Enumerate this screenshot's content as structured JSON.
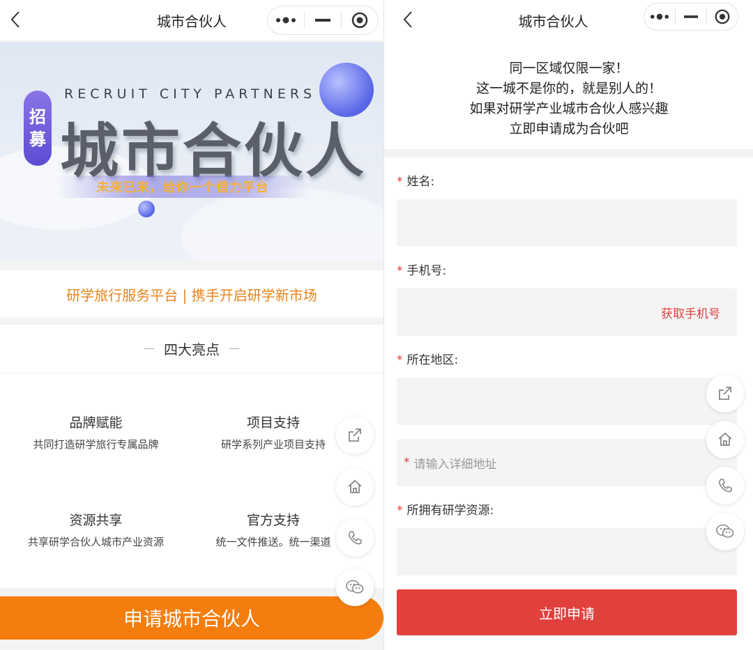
{
  "nav": {
    "title": "城市合伙人"
  },
  "banner": {
    "pill_chars": [
      "招",
      "募"
    ],
    "subtitle_en": "RECRUIT CITY PARTNERS",
    "main_title": "城市合伙人",
    "tagline": "未来已来，给你一个借力平台"
  },
  "slogan": "研学旅行服务平台 | 携手开启研学新市场",
  "features": {
    "heading": "四大亮点",
    "items": [
      {
        "title": "品牌赋能",
        "desc": "共同打造研学旅行专属品牌"
      },
      {
        "title": "项目支持",
        "desc": "研学系列产业项目支持"
      },
      {
        "title": "资源共享",
        "desc": "共享研学合伙人城市产业资源"
      },
      {
        "title": "官方支持",
        "desc": "统一文件推送。统一渠道"
      }
    ]
  },
  "apply_left": "申请城市合伙人",
  "intro": [
    "同一区域仅限一家！",
    "这一城不是你的，就是别人的！",
    "如果对研学产业城市合伙人感兴趣",
    "立即申请成为合伙吧"
  ],
  "form": {
    "required_mark": "*",
    "name_label": "姓名:",
    "phone_label": "手机号:",
    "get_phone": "获取手机号",
    "region_label": "所在地区:",
    "address_placeholder": "请输入详细地址",
    "resources_label": "所拥有研学资源:",
    "submit": "立即申请"
  },
  "icons": [
    "back-icon",
    "more-dots-icon",
    "minimize-icon",
    "close-target-icon",
    "share-icon",
    "home-icon",
    "phone-icon",
    "wechat-icon"
  ],
  "colors": {
    "orange": "#f47d0d",
    "slogan": "#e8831b",
    "red": "#e0413d",
    "purple": "#5b4cd2"
  }
}
